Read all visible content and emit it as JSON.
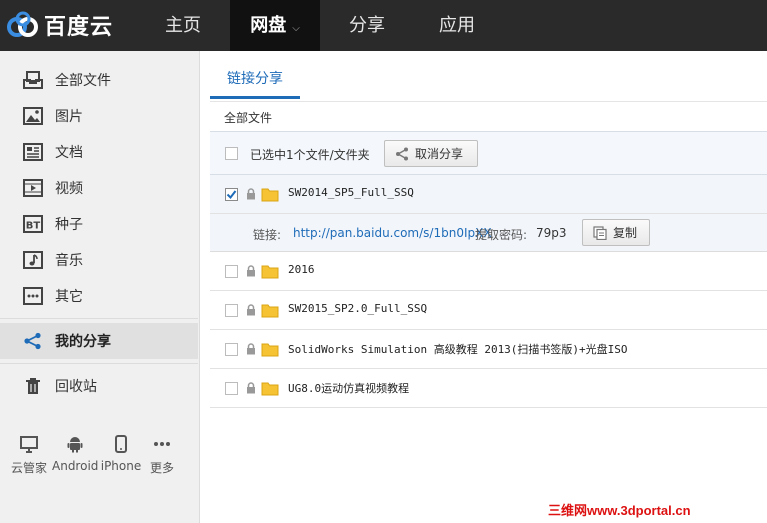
{
  "header": {
    "logo_text": "百度云",
    "nav": [
      {
        "label": "主页"
      },
      {
        "label": "网盘"
      },
      {
        "label": "分享"
      },
      {
        "label": "应用"
      }
    ]
  },
  "sidebar": {
    "items": [
      {
        "label": "全部文件",
        "icon": "file-tray-icon"
      },
      {
        "label": "图片",
        "icon": "image-icon"
      },
      {
        "label": "文档",
        "icon": "document-icon"
      },
      {
        "label": "视频",
        "icon": "video-icon"
      },
      {
        "label": "种子",
        "icon": "bt-icon"
      },
      {
        "label": "音乐",
        "icon": "music-icon"
      },
      {
        "label": "其它",
        "icon": "more-icon"
      },
      {
        "label": "我的分享",
        "icon": "share-icon"
      },
      {
        "label": "回收站",
        "icon": "trash-icon"
      }
    ],
    "devices": [
      {
        "label": "云管家",
        "icon": "monitor-icon"
      },
      {
        "label": "Android",
        "icon": "android-icon"
      },
      {
        "label": "iPhone",
        "icon": "iphone-icon"
      },
      {
        "label": "更多",
        "icon": "ellipsis-icon"
      }
    ]
  },
  "main": {
    "tab": "链接分享",
    "breadcrumb": "全部文件",
    "selection_text": "已选中1个文件/文件夹",
    "cancel_share_label": "取消分享",
    "files": [
      {
        "name": "SW2014_SP5_Full_SSQ",
        "checked": true
      },
      {
        "name": "2016",
        "checked": false
      },
      {
        "name": "SW2015_SP2.0_Full_SSQ",
        "checked": false
      },
      {
        "name": "SolidWorks Simulation 高级教程 2013(扫描书签版)+光盘ISO",
        "checked": false
      },
      {
        "name": "UG8.0运动仿真视频教程",
        "checked": false
      }
    ],
    "link": {
      "label": "链接:",
      "url": "http://pan.baidu.com/s/1bn0IpXX",
      "password_label": "提取密码:",
      "password": "79p3",
      "copy_label": "复制"
    }
  },
  "watermark": "三维网www.3dportal.cn",
  "colors": {
    "accent": "#1e6bb8",
    "header_bg": "#2a2a2a",
    "folder": "#f6c335"
  }
}
